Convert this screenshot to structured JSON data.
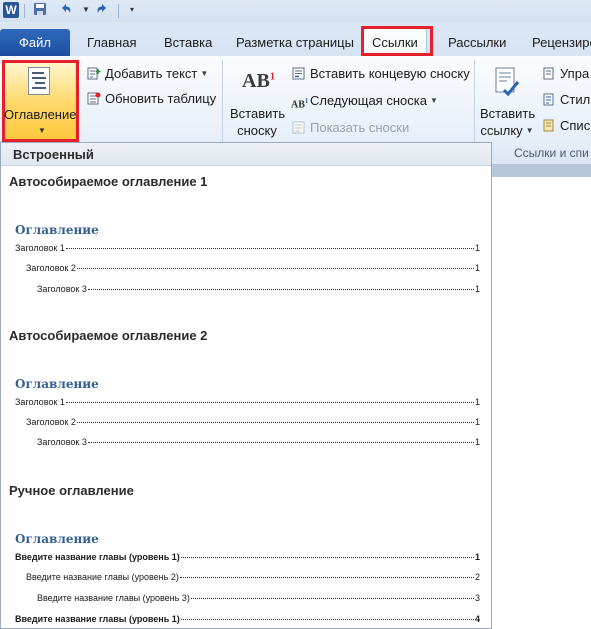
{
  "qat": {
    "app_icon": "W",
    "icons": [
      "save-icon",
      "undo-icon",
      "redo-icon",
      "customize-icon"
    ]
  },
  "tabs": {
    "file": "Файл",
    "home": "Главная",
    "insert": "Вставка",
    "page_layout": "Разметка страницы",
    "references": "Ссылки",
    "mailings": "Рассылки",
    "review": "Рецензиро"
  },
  "ribbon": {
    "toc_button": "Оглавление",
    "add_text": "Добавить текст",
    "update_table": "Обновить таблицу",
    "insert_footnote_line1": "Вставить",
    "insert_footnote_line2": "сноску",
    "footnote_icon_text": "AB",
    "footnote_icon_sup": "1",
    "insert_endnote": "Вставить концевую сноску",
    "next_footnote": "Следующая сноска",
    "show_notes": "Показать сноски",
    "insert_citation_line1": "Вставить",
    "insert_citation_line2": "ссылку",
    "manage_sources": "Упра",
    "style": "Стил",
    "bibliography": "Спис",
    "group_citations": "Ссылки и спи"
  },
  "gallery": {
    "header": "Встроенный",
    "sections": [
      {
        "title": "Автособираемое оглавление 1",
        "heading": "Оглавление",
        "lines": [
          {
            "text": "Заголовок 1",
            "page": "1"
          },
          {
            "text": "Заголовок 2",
            "page": "1"
          },
          {
            "text": "Заголовок 3",
            "page": "1"
          }
        ]
      },
      {
        "title": "Автособираемое оглавление 2",
        "heading": "Оглавление",
        "lines": [
          {
            "text": "Заголовок 1",
            "page": "1"
          },
          {
            "text": "Заголовок 2",
            "page": "1"
          },
          {
            "text": "Заголовок 3",
            "page": "1"
          }
        ]
      },
      {
        "title": "Ручное оглавление",
        "heading": "Оглавление",
        "lines": [
          {
            "text": "Введите название главы (уровень 1)",
            "page": "1"
          },
          {
            "text": "Введите название главы (уровень 2)",
            "page": "2"
          },
          {
            "text": "Введите название главы (уровень 3)",
            "page": "3"
          },
          {
            "text": "Введите название главы (уровень 1)",
            "page": "4"
          }
        ]
      }
    ]
  },
  "colors": {
    "highlight_border": "#e5202a",
    "file_tab": "#2a62b4",
    "toc_heading": "#365f91"
  }
}
